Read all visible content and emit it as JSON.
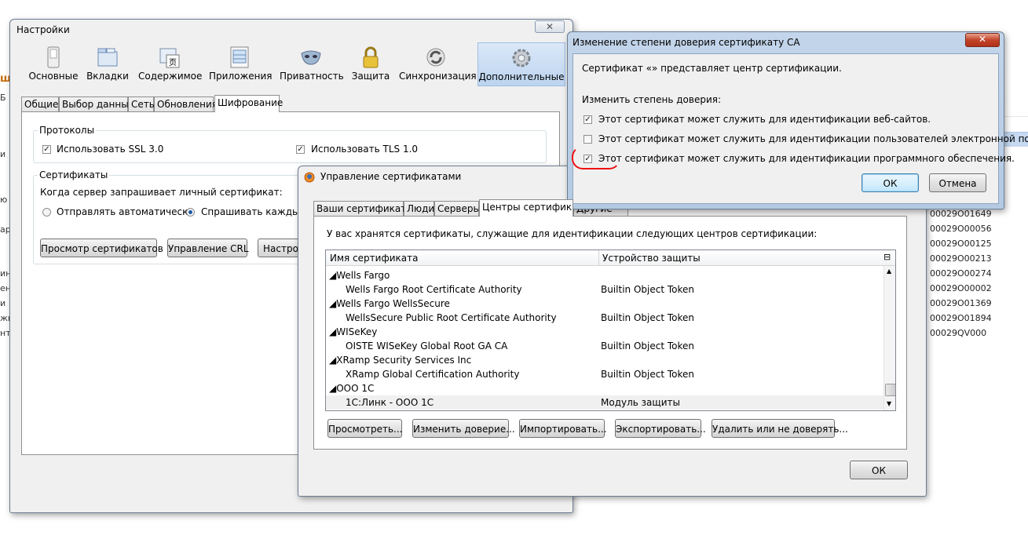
{
  "background": {
    "left_chars": [
      "ш",
      "Б",
      "и",
      "ю",
      "ар",
      "ин",
      "ен",
      "и",
      "жк",
      "нт"
    ],
    "codes": [
      "00029O01649",
      "00029O00056",
      "00029O00125",
      "00029O00213",
      "00029O00274",
      "00029O00002",
      "00029O01369",
      "00029O01894",
      "00029QV000"
    ]
  },
  "settings": {
    "title": "Настройки",
    "close": "✕",
    "toolbar": [
      {
        "label": "Основные",
        "icon": "switch-icon"
      },
      {
        "label": "Вкладки",
        "icon": "tabs-icon"
      },
      {
        "label": "Содержимое",
        "icon": "content-icon"
      },
      {
        "label": "Приложения",
        "icon": "applications-icon"
      },
      {
        "label": "Приватность",
        "icon": "mask-icon"
      },
      {
        "label": "Защита",
        "icon": "lock-icon"
      },
      {
        "label": "Синхронизация",
        "icon": "sync-icon"
      },
      {
        "label": "Дополнительные",
        "icon": "gear-icon"
      }
    ],
    "tabs": [
      "Общие",
      "Выбор данных",
      "Сеть",
      "Обновления",
      "Шифрование"
    ],
    "protocols": {
      "legend": "Протоколы",
      "ssl": "Использовать SSL 3.0",
      "tls": "Использовать TLS 1.0"
    },
    "certs": {
      "legend": "Сертификаты",
      "question": "Когда сервер запрашивает личный сертификат:",
      "auto": "Отправлять автоматически",
      "ask": "Спрашивать каждый р",
      "btn_view": "Просмотр сертификатов",
      "btn_crl": "Управление CRL",
      "btn_setup": "Настрой"
    }
  },
  "certmgr": {
    "title": "Управление сертификатами",
    "tabs": [
      "Ваши сертификаты",
      "Люди",
      "Серверы",
      "Центры сертификации",
      "Другие"
    ],
    "description": "У вас хранятся сертификаты, служащие для идентификации следующих центров сертификации:",
    "columns": [
      "Имя сертификата",
      "Устройство защиты"
    ],
    "rows": [
      {
        "type": "group",
        "name": "Wells Fargo"
      },
      {
        "type": "item",
        "name": "Wells Fargo Root Certificate Authority",
        "device": "Builtin Object Token"
      },
      {
        "type": "group",
        "name": "Wells Fargo WellsSecure"
      },
      {
        "type": "item",
        "name": "WellsSecure Public Root Certificate Authority",
        "device": "Builtin Object Token"
      },
      {
        "type": "group",
        "name": "WISeKey"
      },
      {
        "type": "item",
        "name": "OISTE WISeKey Global Root GA CA",
        "device": "Builtin Object Token"
      },
      {
        "type": "group",
        "name": "XRamp Security Services Inc"
      },
      {
        "type": "item",
        "name": "XRamp Global Certification Authority",
        "device": "Builtin Object Token"
      },
      {
        "type": "group",
        "name": "ООО 1С"
      },
      {
        "type": "item",
        "name": "1С:Линк - ООО 1С",
        "device": "Модуль защиты"
      }
    ],
    "buttons": {
      "view": "Просмотреть...",
      "edit": "Изменить доверие...",
      "import": "Импортировать...",
      "export": "Экспортировать...",
      "delete": "Удалить или не доверять...",
      "ok": "ОК"
    }
  },
  "trust": {
    "title": "Изменение степени доверия сертификату CA",
    "info": "Сертификат «» представляет центр сертификации.",
    "prompt": "Изменить степень доверия:",
    "options": [
      {
        "label": "Этот сертификат может служить для идентификации веб-сайтов.",
        "checked": true
      },
      {
        "label": "Этот сертификат может служить для идентификации пользователей электронной почты.",
        "checked": false
      },
      {
        "label": "Этот сертификат может служить для идентификации программного обеспечения.",
        "checked": true
      }
    ],
    "ok": "ОК",
    "cancel": "Отмена"
  }
}
